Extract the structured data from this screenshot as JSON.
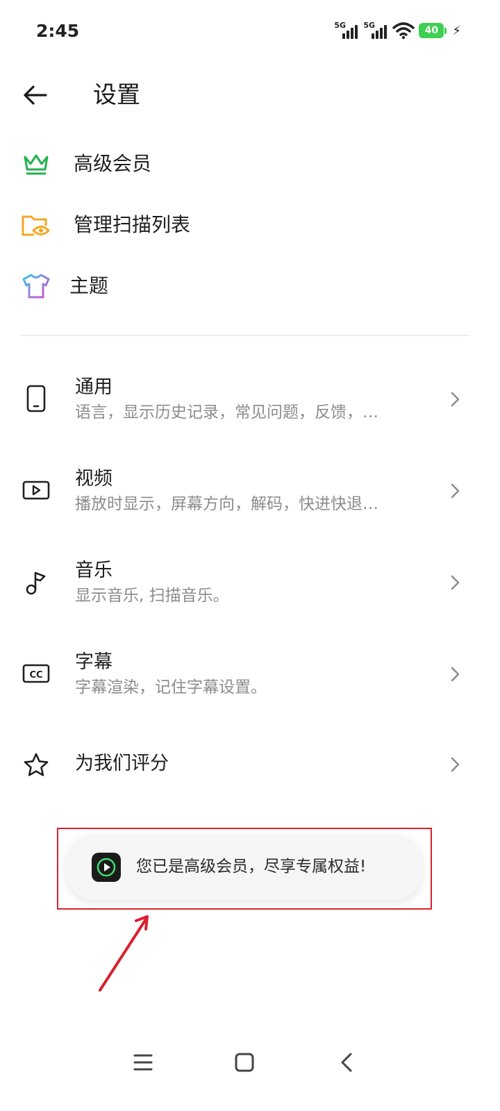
{
  "status_bar": {
    "time": "2:45",
    "network1": "5G",
    "network2": "5G",
    "battery": "40"
  },
  "header": {
    "title": "设置"
  },
  "top_items": [
    {
      "label": "高级会员",
      "icon": "crown-icon",
      "color": "#22b14c"
    },
    {
      "label": "管理扫描列表",
      "icon": "folder-eye-icon",
      "color": "#f5a623"
    },
    {
      "label": "主题",
      "icon": "tshirt-icon",
      "color": "#c64bd8"
    }
  ],
  "settings": [
    {
      "title": "通用",
      "subtitle": "语言，显示历史记录，常见问题，反馈，…",
      "icon": "phone-icon"
    },
    {
      "title": "视频",
      "subtitle": "播放时显示，屏幕方向，解码，快进快退…",
      "icon": "video-play-icon"
    },
    {
      "title": "音乐",
      "subtitle": "显示音乐, 扫描音乐。",
      "icon": "music-note-icon"
    },
    {
      "title": "字幕",
      "subtitle": "字幕渲染，记住字幕设置。",
      "icon": "cc-icon"
    },
    {
      "title": "为我们评分",
      "subtitle": "",
      "icon": "star-icon"
    }
  ],
  "toast": {
    "message": "您已是高级会员，尽享专属权益!",
    "icon": "app-play-icon"
  },
  "colors": {
    "annotation_red": "#d9202c",
    "subtitle_gray": "#8c8c8c"
  }
}
